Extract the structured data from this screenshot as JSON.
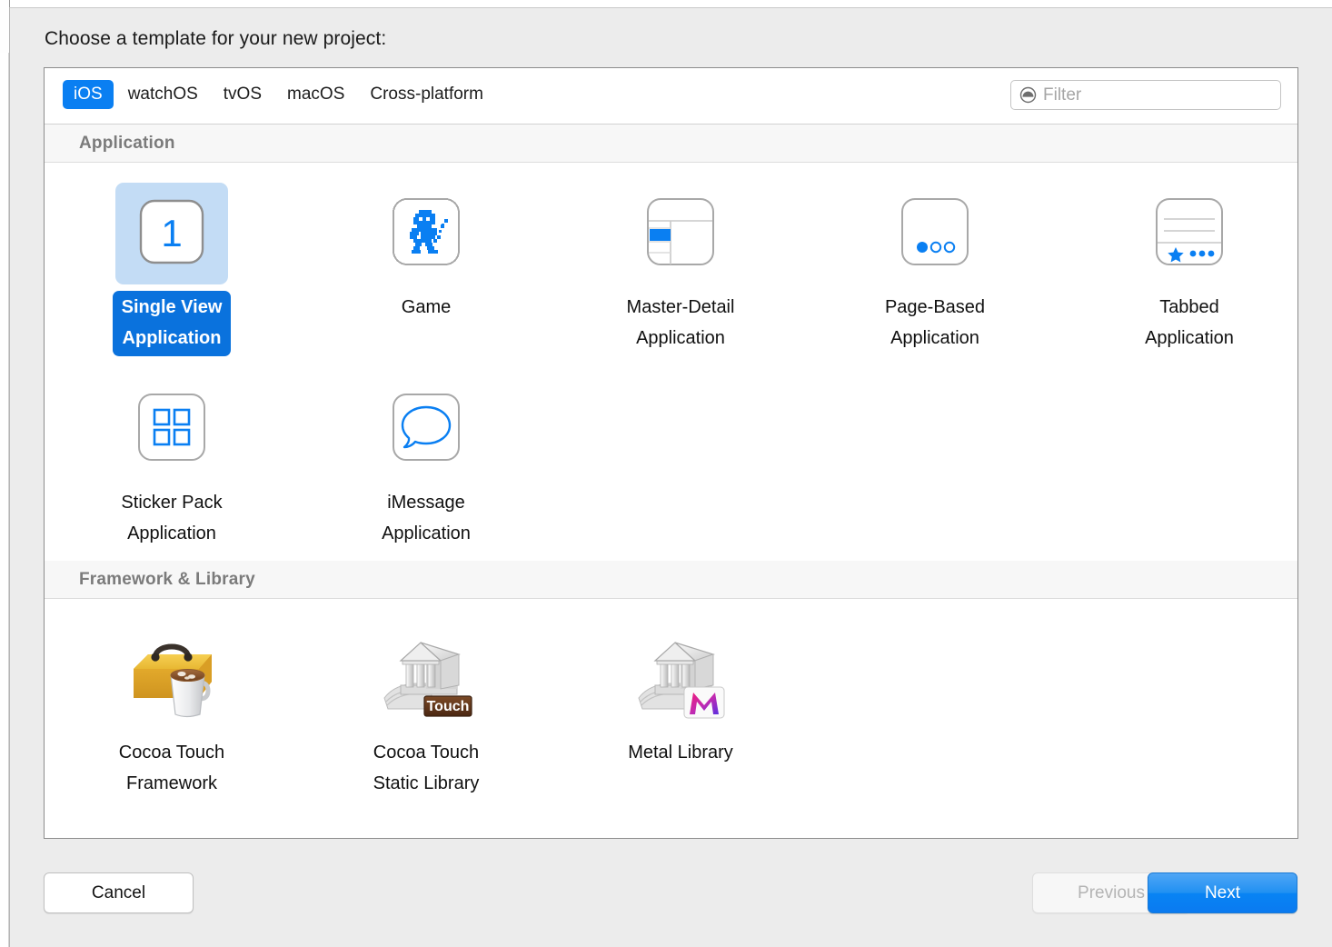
{
  "dialog": {
    "prompt": "Choose a template for your new project:"
  },
  "platform_tabs": [
    {
      "label": "iOS",
      "active": true
    },
    {
      "label": "watchOS",
      "active": false
    },
    {
      "label": "tvOS",
      "active": false
    },
    {
      "label": "macOS",
      "active": false
    },
    {
      "label": "Cross-platform",
      "active": false
    }
  ],
  "filter": {
    "value": "",
    "placeholder": "Filter",
    "icon": "filter-icon"
  },
  "sections": [
    {
      "title": "Application",
      "rows": [
        [
          {
            "label": "Single View\nApplication",
            "icon": "single-view-icon",
            "selected": true
          },
          {
            "label": "Game",
            "icon": "game-sprite-icon",
            "selected": false
          },
          {
            "label": "Master-Detail\nApplication",
            "icon": "master-detail-icon",
            "selected": false
          },
          {
            "label": "Page-Based\nApplication",
            "icon": "page-based-icon",
            "selected": false
          },
          {
            "label": "Tabbed\nApplication",
            "icon": "tabbed-icon",
            "selected": false
          }
        ],
        [
          {
            "label": "Sticker Pack\nApplication",
            "icon": "sticker-pack-icon",
            "selected": false
          },
          {
            "label": "iMessage\nApplication",
            "icon": "imessage-bubble-icon",
            "selected": false
          }
        ]
      ]
    },
    {
      "title": "Framework & Library",
      "rows": [
        [
          {
            "label": "Cocoa Touch\nFramework",
            "icon": "toolbox-coffee-icon",
            "selected": false
          },
          {
            "label": "Cocoa Touch\nStatic Library",
            "icon": "library-touch-icon",
            "selected": false
          },
          {
            "label": "Metal Library",
            "icon": "library-metal-icon",
            "selected": false
          }
        ]
      ]
    }
  ],
  "footer": {
    "cancel_label": "Cancel",
    "previous_label": "Previous",
    "next_label": "Next"
  },
  "colors": {
    "accent_blue": "#0a7ff2",
    "selection_fill": "#c3dcf5",
    "selected_label_bg": "#0a72dd",
    "section_header_text": "#7b7b7b",
    "disabled_text": "#b4b4b4"
  }
}
